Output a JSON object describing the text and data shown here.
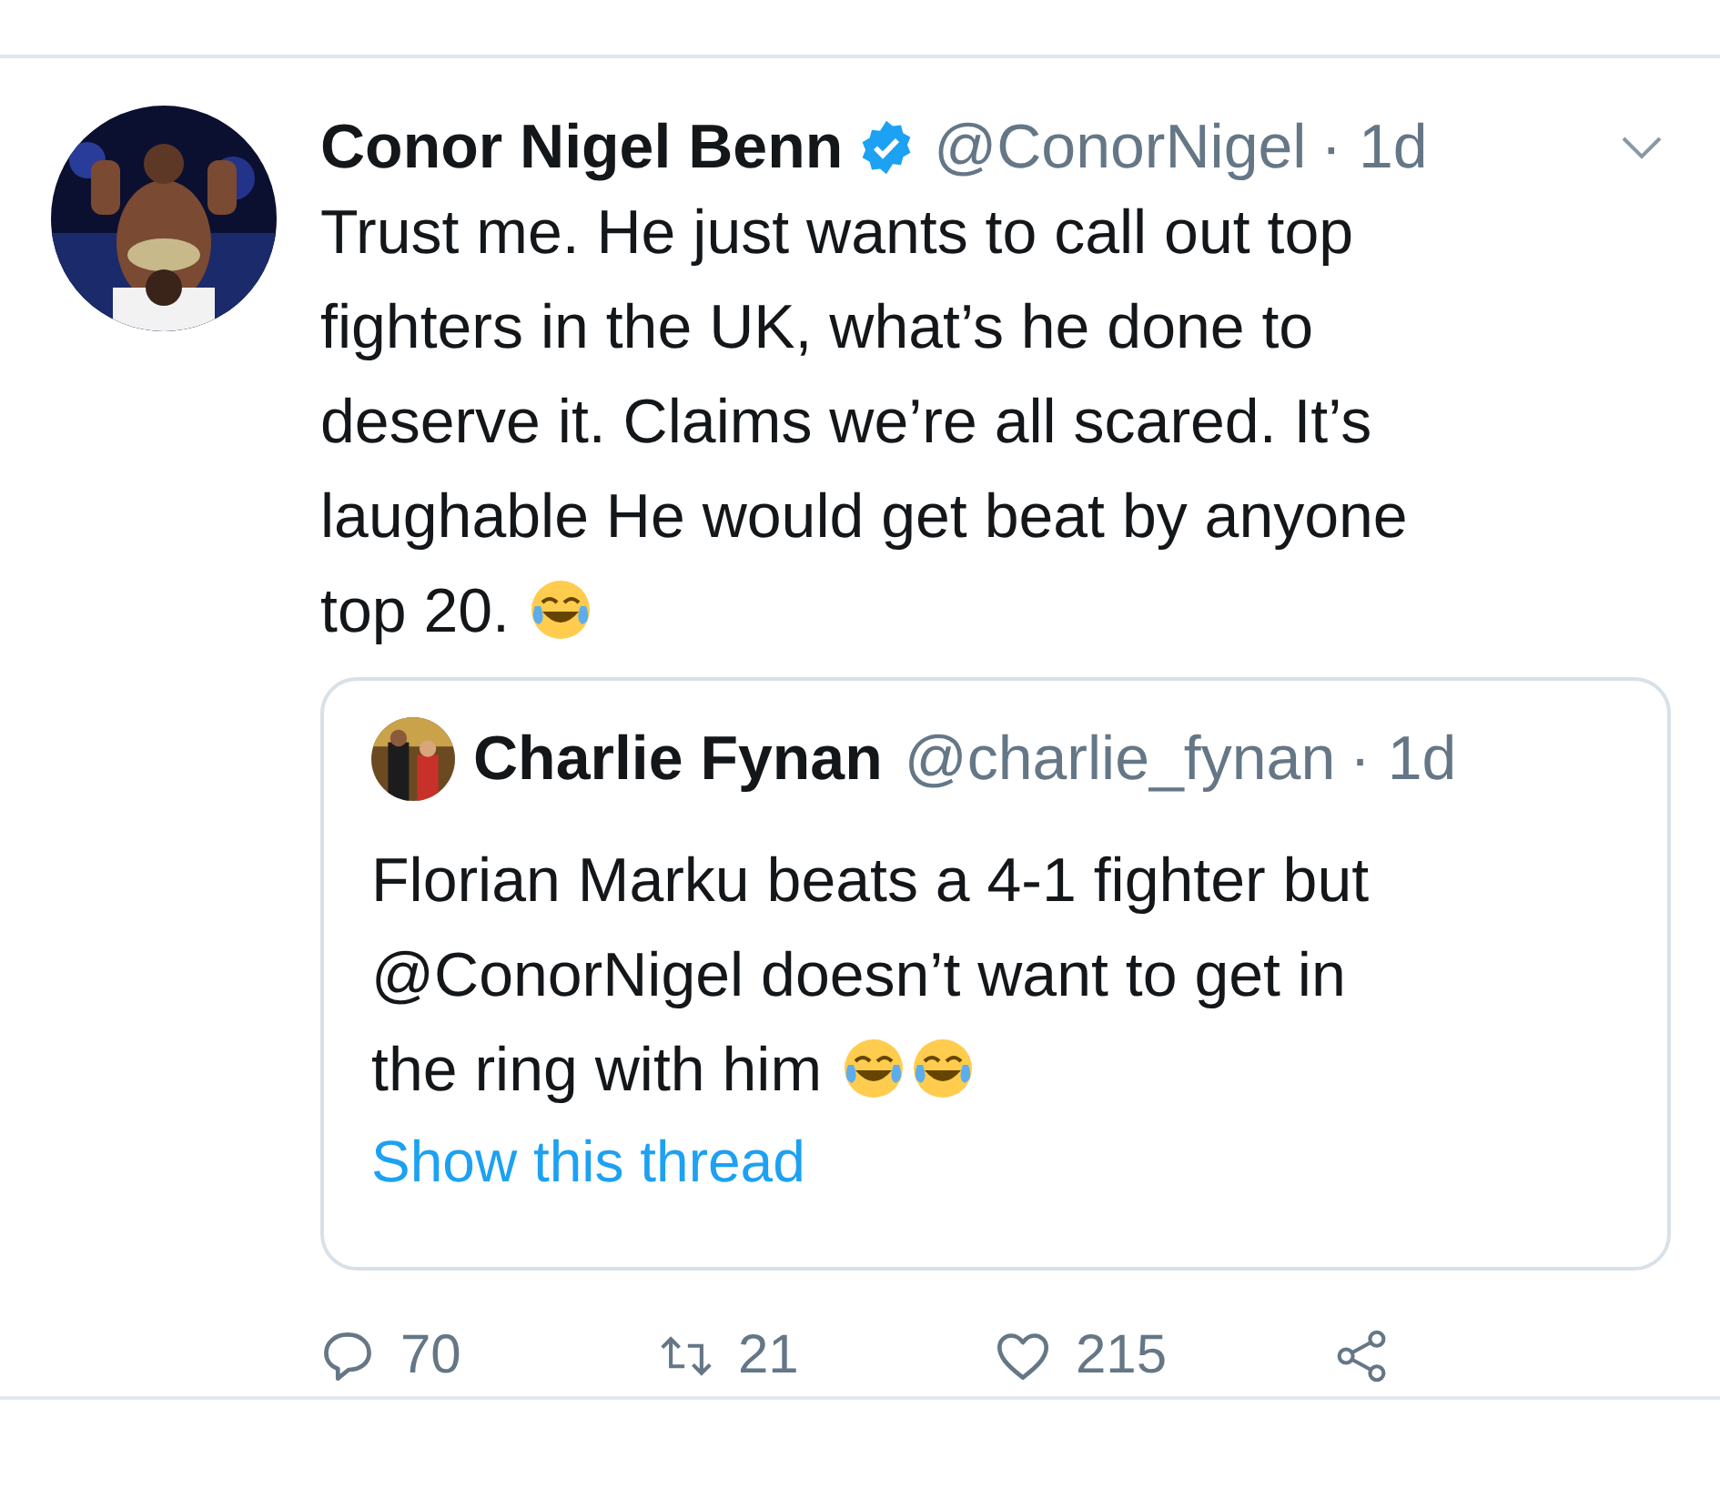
{
  "tweet": {
    "name": "Conor Nigel Benn",
    "verified": true,
    "handle": "@ConorNigel",
    "time": "· 1d",
    "lines": [
      "Trust me. He just wants to call out top",
      "fighters in the UK, what’s he done to",
      "deserve it. Claims we’re all scared. It’s",
      "laughable He would get beat by anyone",
      "top 20."
    ],
    "emojis": [
      {
        "kind": "tears_of_joy"
      }
    ],
    "quote": {
      "name": "Charlie Fynan",
      "handle": "@charlie_fynan",
      "time": "· 1d",
      "lines": [
        "Florian Marku beats a 4-1 fighter but",
        "@ConorNigel doesn’t want to get in",
        "the ring with him"
      ],
      "emojis": [
        {
          "kind": "tears_of_joy"
        },
        {
          "kind": "tears_of_joy"
        }
      ],
      "link": "Show this thread"
    },
    "actions": [
      {
        "kind": "reply",
        "count": "70"
      },
      {
        "kind": "retweet",
        "count": "21"
      },
      {
        "kind": "like",
        "count": "215"
      },
      {
        "kind": "share"
      }
    ]
  }
}
